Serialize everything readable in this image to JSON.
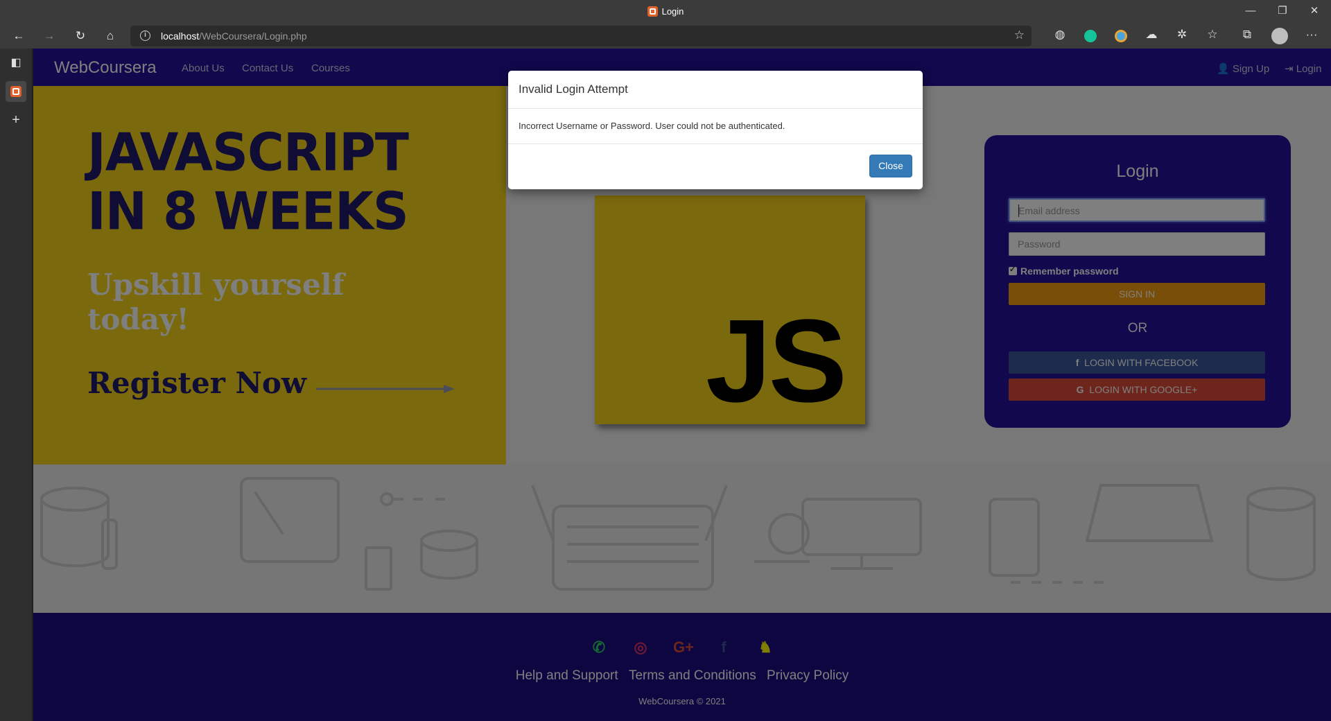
{
  "window": {
    "title": "Login",
    "minimize_glyph": "—",
    "restore_glyph": "❐",
    "close_glyph": "✕"
  },
  "toolbar": {
    "url_host": "localhost",
    "url_path": "/WebCoursera/Login.php",
    "icons": [
      "back-icon",
      "forward-icon",
      "refresh-icon",
      "home-icon",
      "site-info-icon",
      "add-favorite-icon",
      "vpn-extension-icon",
      "grammarly-extension-icon",
      "ghostery-extension-icon",
      "cloud-extension-icon",
      "extensions-icon",
      "favorites-icon",
      "collections-icon",
      "profile-icon",
      "more-icon"
    ]
  },
  "navbar": {
    "brand": "WebCoursera",
    "links": [
      "About Us",
      "Contact Us",
      "Courses"
    ],
    "signup": "Sign Up",
    "login": "Login"
  },
  "hero": {
    "headline_line1": "JAVASCRIPT",
    "headline_line2": "IN 8 WEEKS",
    "subheadline_line1": "Upskill yourself",
    "subheadline_line2": "today!",
    "cta": "Register Now",
    "logo_text": "JS"
  },
  "login_form": {
    "title": "Login",
    "email_placeholder": "Email address",
    "password_placeholder": "Password",
    "remember_label": "Remember password",
    "remember_checked": true,
    "sign_in": "SIGN IN",
    "or": "OR",
    "facebook": "LOGIN WITH FACEBOOK",
    "google": "LOGIN WITH GOOGLE+",
    "colors": {
      "card": "#23109a",
      "sign_in": "#f39c12",
      "facebook": "#3b5998",
      "google": "#dd4b39"
    }
  },
  "footer": {
    "social_icons": [
      "whatsapp-icon",
      "instagram-icon",
      "google-plus-icon",
      "facebook-icon",
      "snapchat-icon"
    ],
    "links": [
      "Help and Support",
      "Terms and Conditions",
      "Privacy Policy"
    ],
    "copyright": "WebCoursera © 2021"
  },
  "modal": {
    "title": "Invalid Login Attempt",
    "message": "Incorrect Username or Password. User could not be authenticated.",
    "close": "Close"
  }
}
